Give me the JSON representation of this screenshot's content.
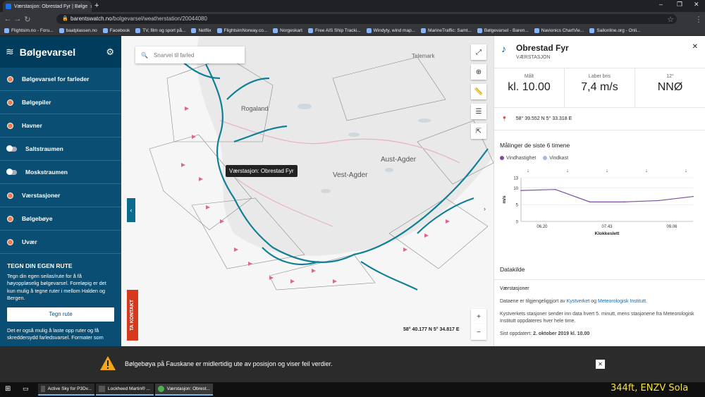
{
  "browser": {
    "tab_title": "Værstasjon: Obrestad Fyr | Bølge",
    "url_host": "barentswatch.no",
    "url_path": "/bolgevarsel/weatherstation/20044080",
    "bookmarks": [
      "Flightsim.no - Foru...",
      "baatplassen.no",
      "Facebook",
      "TV, film og sport på...",
      "Netflix",
      "FlightsimNorway.co...",
      "Norgeskart",
      "Free AIS Ship Tracki...",
      "Windyty, wind map...",
      "MarineTraffic: Samt...",
      "Bølgevarsel - Baren...",
      "Navionics ChartVie...",
      "Sailonline.org - Onli..."
    ]
  },
  "sidebar": {
    "title": "Bølgevarsel",
    "items": [
      {
        "label": "Bølgevarsel for farleder",
        "kind": "dot"
      },
      {
        "label": "Bølgepiler",
        "kind": "dot"
      },
      {
        "label": "Havner",
        "kind": "dot"
      },
      {
        "label": "Saltstraumen",
        "kind": "toggle"
      },
      {
        "label": "Moskstraumen",
        "kind": "toggle"
      },
      {
        "label": "Værstasjoner",
        "kind": "dot"
      },
      {
        "label": "Bølgebøye",
        "kind": "dot"
      },
      {
        "label": "Uvær",
        "kind": "dot"
      }
    ],
    "route_heading": "TEGN DIN EGEN RUTE",
    "route_text": "Tegn din egen seilas/rute for å få høyoppløselig bølgevarsel. Foreløpig er det kun mulig å tegne ruter i mellom Halden og Bergen.",
    "route_button": "Tegn rute",
    "route_more": "Det er også mulig å laste opp ruter og få skreddersydd farledsvarsel. Formater som"
  },
  "map": {
    "search_placeholder": "Snarvei til farled",
    "tooltip": "Værstasjon: Obrestad Fyr",
    "coords": "58° 40.177 N 5° 34.817 E",
    "contact_tab": "TA KONTAKT",
    "labels": [
      "Rogaland",
      "Telemark",
      "Aust-Agder",
      "Vest-Agder"
    ]
  },
  "panel": {
    "title": "Obrestad Fyr",
    "subtitle": "VÆRSTASJON",
    "stats": [
      {
        "label": "Målt",
        "value": "kl. 10.00"
      },
      {
        "label": "Laber bris",
        "value": "7,4 m/s"
      },
      {
        "label": "12°",
        "value": "NNØ"
      }
    ],
    "position": "58° 39.552 N 5° 33.318 E",
    "meas_title": "Målinger de siste 6 timene",
    "legend": [
      {
        "name": "Vindhastighet",
        "color": "#7b4f9e"
      },
      {
        "name": "Vindkast",
        "color": "#a6b8e6"
      }
    ],
    "source_heading": "Datakilde",
    "source_sub": "Værstasjoner",
    "source_p1_pre": "Dataene er tilgjengeliggjort av ",
    "source_link1": "Kystverket",
    "source_p1_mid": " og ",
    "source_link2": "Meteorologisk Institutt",
    "source_p1_post": ".",
    "source_p2": "Kystverkets stasjoner sender inn data hvert 5. minutt, mens stasjonene fra Meteorologisk Institutt oppdateres hver hele time.",
    "updated_label": "Sist oppdatert: ",
    "updated_value": "2. oktober 2019 kl. 10.00"
  },
  "chart_data": {
    "type": "line",
    "title": "",
    "xlabel": "Klokkeslett",
    "ylabel": "m/s",
    "x_ticks": [
      "06.20",
      "07.43",
      "09.06"
    ],
    "y_ticks": [
      0,
      5,
      10,
      13
    ],
    "ylim": [
      0,
      13
    ],
    "series": [
      {
        "name": "Vindhastighet",
        "x": [
          "05.30",
          "06.30",
          "07.30",
          "08.30",
          "09.30",
          "10.00"
        ],
        "values": [
          9.2,
          9.5,
          5.8,
          5.8,
          6.2,
          7.4
        ]
      }
    ]
  },
  "notice": {
    "text": "Bølgebøya på Fauskane er midlertidig ute av posisjon og viser feil verdier."
  },
  "taskbar": {
    "items": [
      "Active Sky for P3Dv...",
      "Lockheed Martin® ...",
      "Værstasjon: Obrest..."
    ]
  },
  "overlay": {
    "text": "344ft, ENZV Sola"
  }
}
